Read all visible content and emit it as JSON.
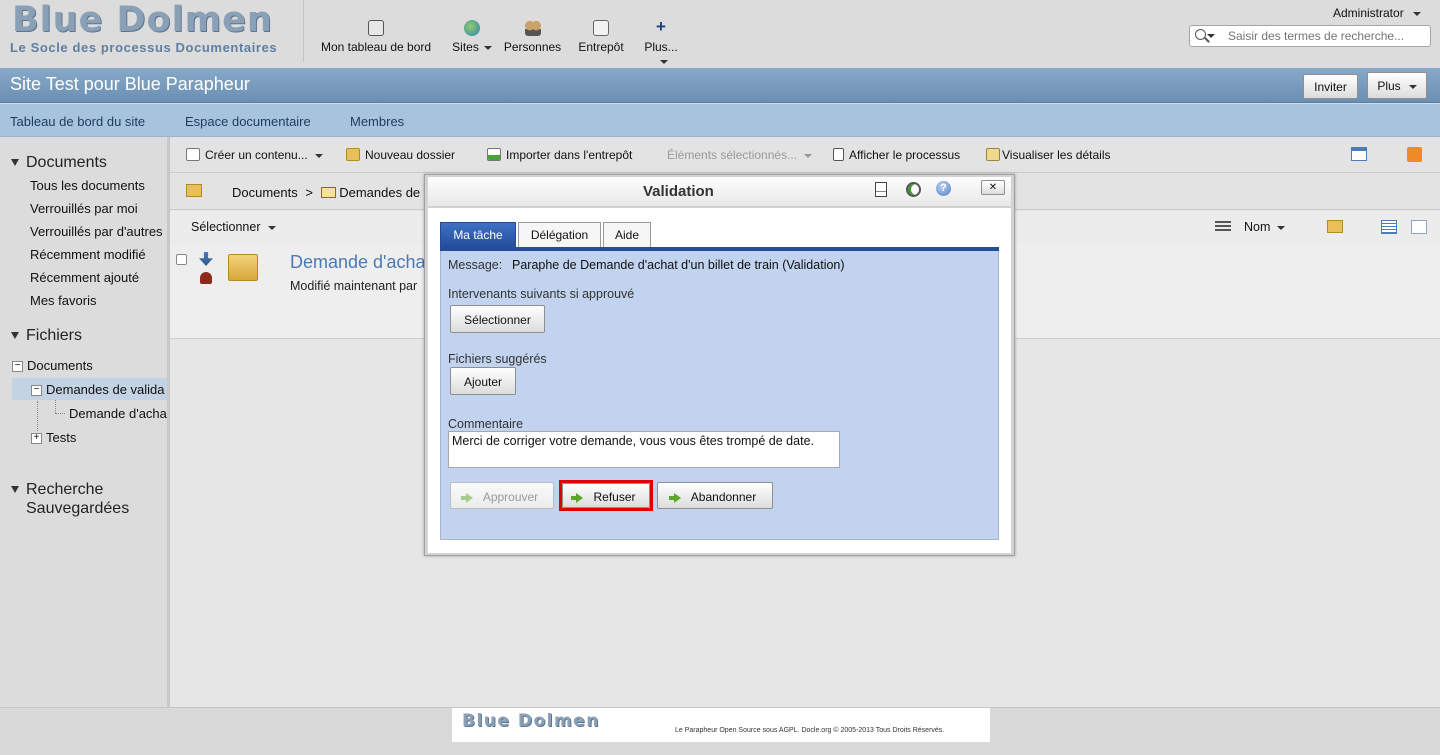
{
  "header": {
    "logo_title": "Blue Dolmen",
    "logo_subtitle": "Le Socle des processus Documentaires",
    "apps": [
      {
        "label": "Mon tableau de bord",
        "icon": "dashboard-icon"
      },
      {
        "label": "Sites",
        "icon": "globe-icon"
      },
      {
        "label": "Personnes",
        "icon": "people-icon"
      },
      {
        "label": "Entrepôt",
        "icon": "repository-icon"
      },
      {
        "label": "Plus...",
        "icon": "plus-icon"
      }
    ],
    "user": "Administrator",
    "search_placeholder": "Saisir des termes de recherche..."
  },
  "site": {
    "title": "Site Test pour Blue Parapheur",
    "invite_label": "Inviter",
    "more_label": "Plus",
    "nav": [
      "Tableau de bord du site",
      "Espace documentaire",
      "Membres"
    ]
  },
  "left": {
    "documents_heading": "Documents",
    "documents_links": [
      "Tous les documents",
      "Verrouillés par moi",
      "Verrouillés par d'autres",
      "Récemment modifié",
      "Récemment ajouté",
      "Mes favoris"
    ],
    "files_heading": "Fichiers",
    "tree_root": "Documents",
    "tree_child": "Demandes de valida",
    "tree_grandchild": "Demande d'acha",
    "tree_tests": "Tests",
    "saved_heading_1": "Recherche",
    "saved_heading_2": "Sauvegardées"
  },
  "toolbar": {
    "create": "Créer un contenu...",
    "new_folder": "Nouveau dossier",
    "import": "Importer dans l'entrepôt",
    "selected": "Éléments sélectionnés...",
    "show_process": "Afficher le processus",
    "view_details": "Visualiser les détails"
  },
  "breadcrumb": {
    "root": "Documents",
    "separator": ">",
    "folder": "Demandes de v"
  },
  "list": {
    "select_label": "Sélectionner",
    "sort_label": "Nom",
    "item_title": "Demande d'acha",
    "item_meta": "Modifié maintenant par"
  },
  "dialog": {
    "title": "Validation",
    "tabs": [
      "Ma tâche",
      "Délégation",
      "Aide"
    ],
    "message_label": "Message:",
    "message_value": "Paraphe de Demande d'achat d'un billet de train (Validation)",
    "next_label": "Intervenants suivants si approuvé",
    "select_button": "Sélectionner",
    "files_label": "Fichiers suggérés",
    "add_button": "Ajouter",
    "comment_label": "Commentaire",
    "comment_value": "Merci de corriger votre demande, vous vous êtes trompé de date.",
    "approve_button": "Approuver",
    "reject_button": "Refuser",
    "abandon_button": "Abandonner",
    "close_symbol": "✕"
  },
  "footer": {
    "logo": "Blue Dolmen",
    "text": "Le Parapheur Open Source sous AGPL. Docle.org © 2005-2013 Tous Droits Réservés."
  },
  "colors": {
    "titlebar": "#7a9cc0",
    "sitenav": "#a7c4df",
    "tab_active": "#244e9c",
    "panel": "#c1d3ee",
    "highlight": "#e00000"
  }
}
